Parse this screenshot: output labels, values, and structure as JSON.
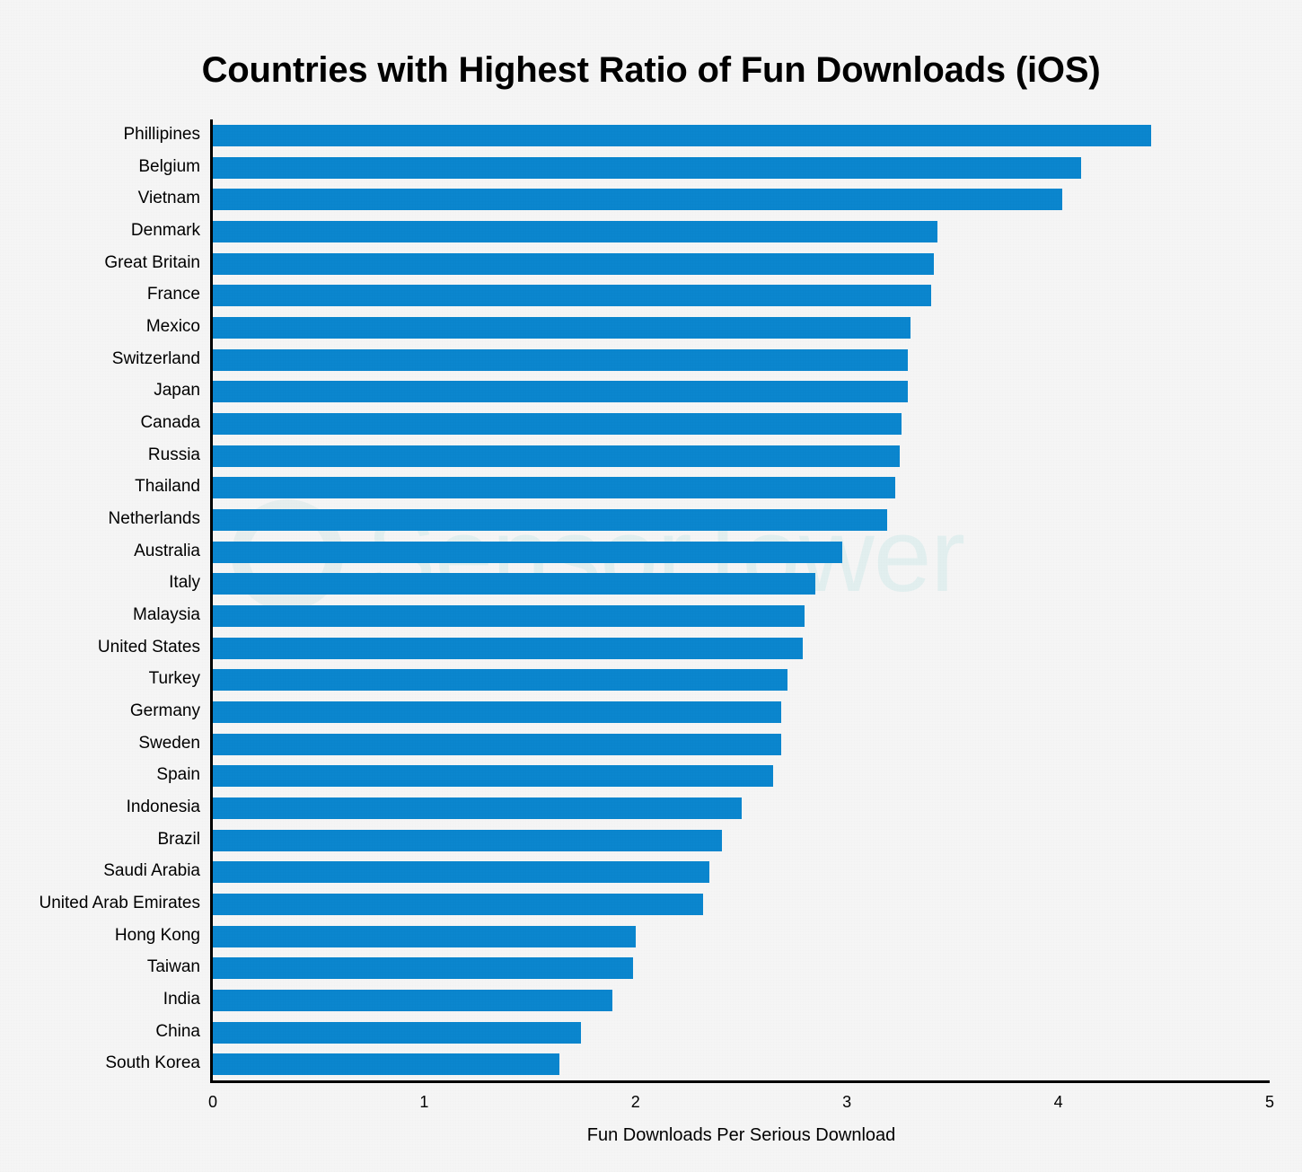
{
  "chart_data": {
    "type": "bar",
    "orientation": "horizontal",
    "title": "Countries with Highest Ratio of Fun Downloads (iOS)",
    "xlabel": "Fun Downloads Per Serious Download",
    "ylabel": "",
    "xlim": [
      0,
      5
    ],
    "xticks": [
      0,
      1,
      2,
      3,
      4,
      5
    ],
    "xtick_labels": [
      "0",
      "1",
      "2",
      "3",
      "4",
      "5"
    ],
    "grid": false,
    "legend": false,
    "bar_color": "#0b86ce",
    "background_color": "#f5f5f5",
    "categories": [
      "Phillipines",
      "Belgium",
      "Vietnam",
      "Denmark",
      "Great Britain",
      "France",
      "Mexico",
      "Switzerland",
      "Japan",
      "Canada",
      "Russia",
      "Thailand",
      "Netherlands",
      "Australia",
      "Italy",
      "Malaysia",
      "United States",
      "Turkey",
      "Germany",
      "Sweden",
      "Spain",
      "Indonesia",
      "Brazil",
      "Saudi Arabia",
      "United Arab Emirates",
      "Hong Kong",
      "Taiwan",
      "India",
      "China",
      "South Korea"
    ],
    "values": [
      4.44,
      4.11,
      4.02,
      3.43,
      3.41,
      3.4,
      3.3,
      3.29,
      3.29,
      3.26,
      3.25,
      3.23,
      3.19,
      2.98,
      2.85,
      2.8,
      2.79,
      2.72,
      2.69,
      2.69,
      2.65,
      2.5,
      2.41,
      2.35,
      2.32,
      2.0,
      1.99,
      1.89,
      1.74,
      1.64
    ]
  },
  "watermark": {
    "text": "SensorTower",
    "logo_icon": "circle-logo-icon",
    "color": "#e2efef"
  }
}
